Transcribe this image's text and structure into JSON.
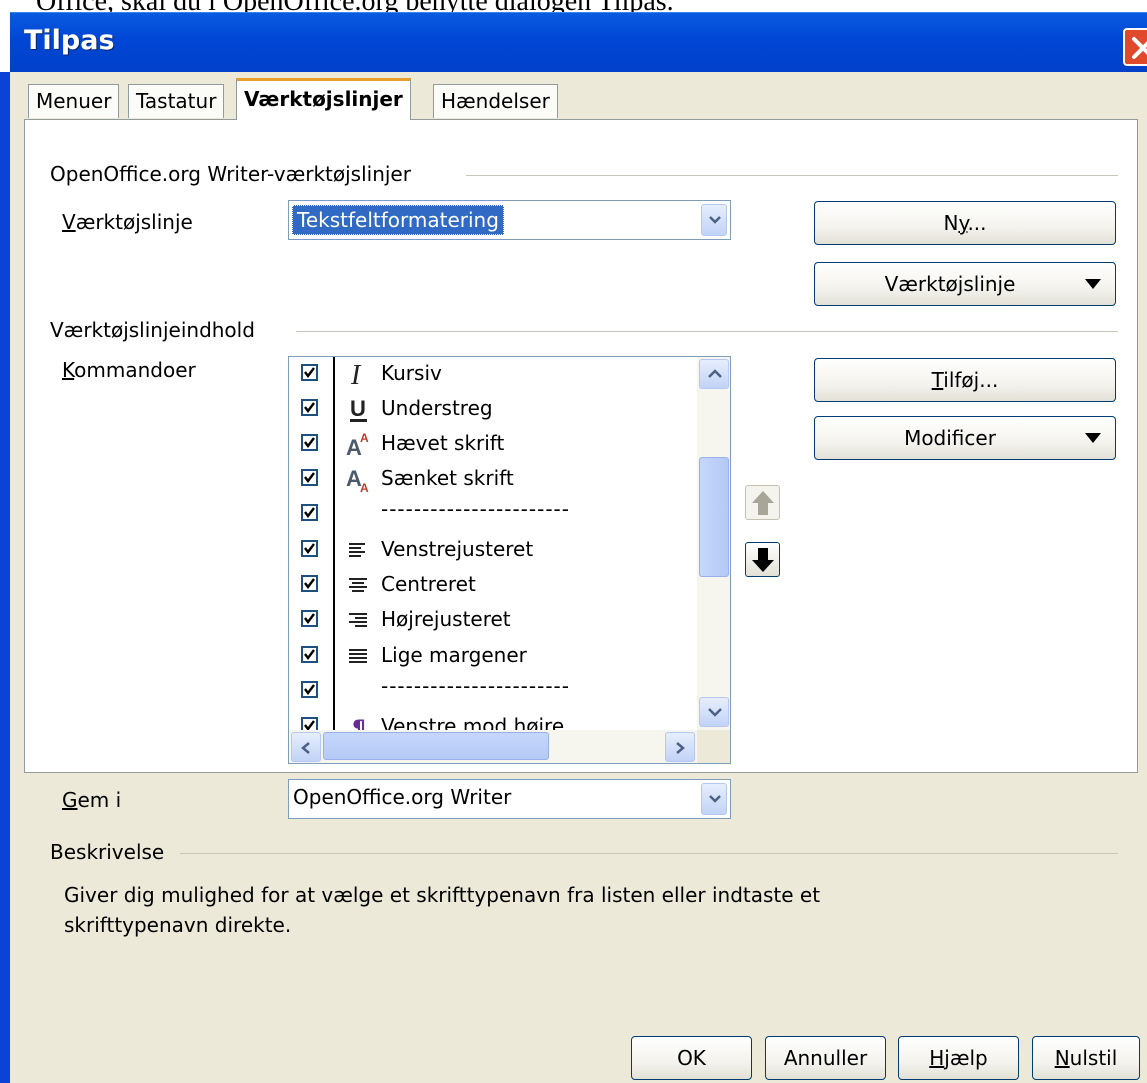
{
  "doc_snippet": "Office, skal du i OpenOffice.org benytte dialogen Tilpas.",
  "window": {
    "title": "Tilpas"
  },
  "tabs": [
    {
      "label": "Menuer"
    },
    {
      "label": "Tastatur"
    },
    {
      "label": "Værktøjslinjer",
      "active": true
    },
    {
      "label": "Hændelser"
    }
  ],
  "toolbars_section": {
    "heading": "OpenOffice.org Writer-værktøjslinjer",
    "toolbar_label_pre": "V",
    "toolbar_label_post": "ærktøjslinje",
    "toolbar_value": "Tekstfeltformatering",
    "new_button": {
      "pre": "N",
      "u": "y",
      "post": "..."
    },
    "toolbar_menu_button": "Værktøjslinje"
  },
  "content_section": {
    "heading": "Værktøjslinjeindhold",
    "commands_label_u": "K",
    "commands_label_post": "ommandoer",
    "commands": [
      {
        "label": "Kursiv",
        "checked": true,
        "icon": "italic-icon"
      },
      {
        "label": "Understreg",
        "checked": true,
        "icon": "underline-icon"
      },
      {
        "label": "Hævet skrift",
        "checked": true,
        "icon": "superscript-icon"
      },
      {
        "label": "Sænket skrift",
        "checked": true,
        "icon": "subscript-icon"
      },
      {
        "label": "-----------------------",
        "checked": true,
        "icon": "separator"
      },
      {
        "label": "Venstrejusteret",
        "checked": true,
        "icon": "align-left-icon"
      },
      {
        "label": "Centreret",
        "checked": true,
        "icon": "align-center-icon"
      },
      {
        "label": "Højrejusteret",
        "checked": true,
        "icon": "align-right-icon"
      },
      {
        "label": "Lige margener",
        "checked": true,
        "icon": "justify-icon"
      },
      {
        "label": "-----------------------",
        "checked": true,
        "icon": "separator"
      },
      {
        "label": "Venstre mod højre",
        "checked": true,
        "icon": "ltr-paragraph-icon"
      }
    ],
    "add_button": {
      "u": "T",
      "post": "ilføj..."
    },
    "modify_button": "Modificer",
    "save_in_label_u": "G",
    "save_in_label_post": "em i",
    "save_in_value": "OpenOffice.org Writer"
  },
  "description": {
    "heading": "Beskrivelse",
    "text": "Giver dig mulighed for at vælge et skrifttypenavn fra listen eller indtaste et skrifttypenavn direkte."
  },
  "footer": {
    "ok": "OK",
    "cancel": "Annuller",
    "help_u": "H",
    "help_post": "jælp",
    "reset_u": "N",
    "reset_post": "ulstil"
  },
  "colors": {
    "titlebar": "#0046d5",
    "frame": "#ece9d8",
    "selection": "#316ac5",
    "active_tab": "#e8a02c"
  }
}
